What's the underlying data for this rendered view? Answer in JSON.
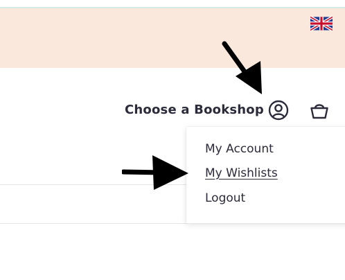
{
  "header": {
    "language_flag_icon": "uk-flag-icon",
    "choose_bookshop": "Choose a Bookshop",
    "account_icon": "user-circle-icon",
    "basket_icon": "basket-icon"
  },
  "account_menu": {
    "items": [
      {
        "label": "My Account"
      },
      {
        "label": "My Wishlists"
      },
      {
        "label": "Logout"
      }
    ]
  },
  "colors": {
    "promo_band": "#fbe8dc",
    "text": "#2b2b3a",
    "arrow": "#000000"
  }
}
